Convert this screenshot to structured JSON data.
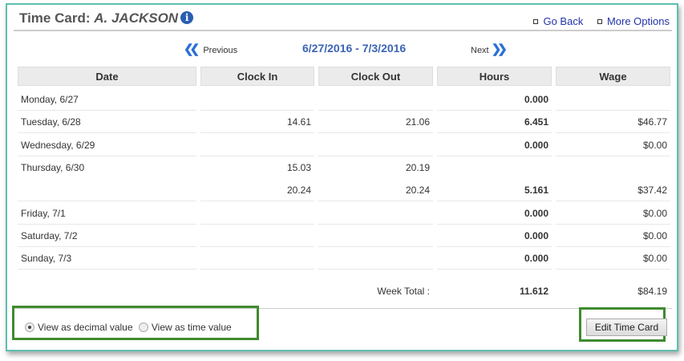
{
  "header": {
    "title_prefix": "Time Card:",
    "employee": "A. JACKSON",
    "info_icon": "i",
    "go_back": "Go Back",
    "more_options": "More Options"
  },
  "nav": {
    "previous": "Previous",
    "next": "Next",
    "range": "6/27/2016 - 7/3/2016"
  },
  "table": {
    "columns": [
      "Date",
      "Clock In",
      "Clock Out",
      "Hours",
      "Wage"
    ],
    "rows": [
      {
        "date": "Monday, 6/27",
        "in": "",
        "out": "",
        "hours": "0.000",
        "wage": ""
      },
      {
        "date": "Tuesday, 6/28",
        "in": "14.61",
        "out": "21.06",
        "hours": "6.451",
        "wage": "$46.77"
      },
      {
        "date": "Wednesday, 6/29",
        "in": "",
        "out": "",
        "hours": "0.000",
        "wage": "$0.00"
      },
      {
        "date": "Thursday, 6/30",
        "in": "15.03",
        "out": "20.19",
        "hours": "",
        "wage": ""
      },
      {
        "date": "",
        "in": "20.24",
        "out": "20.24",
        "hours": "5.161",
        "wage": "$37.42"
      },
      {
        "date": "Friday, 7/1",
        "in": "",
        "out": "",
        "hours": "0.000",
        "wage": "$0.00"
      },
      {
        "date": "Saturday, 7/2",
        "in": "",
        "out": "",
        "hours": "0.000",
        "wage": "$0.00"
      },
      {
        "date": "Sunday, 7/3",
        "in": "",
        "out": "",
        "hours": "0.000",
        "wage": "$0.00"
      }
    ],
    "total_label": "Week Total :",
    "total_hours": "11.612",
    "total_wage": "$84.19"
  },
  "footer": {
    "decimal_label": "View as decimal value",
    "time_label": "View as time value",
    "edit_button": "Edit Time Card"
  }
}
